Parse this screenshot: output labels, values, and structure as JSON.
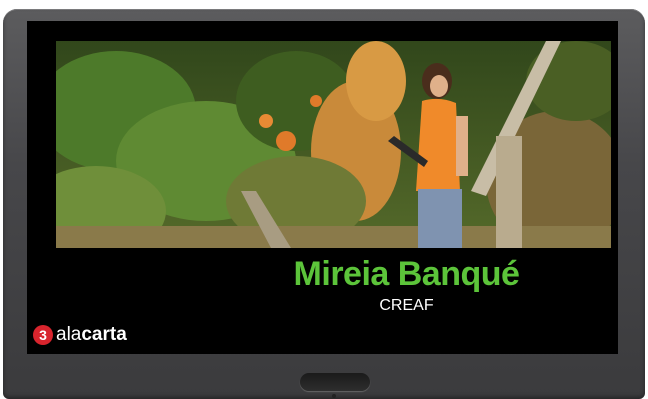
{
  "caption": {
    "name": "Mireia Banqué",
    "organization": "CREAF"
  },
  "logo": {
    "badge_number": "3",
    "text_light": "ala",
    "text_bold": "carta"
  },
  "colors": {
    "name_green": "#5cc43a",
    "logo_red": "#d8242d",
    "bezel": "#4a4a4c",
    "screen": "#000000"
  },
  "icons": {
    "tv": "television-icon",
    "logo_badge": "tv3-badge-icon"
  }
}
